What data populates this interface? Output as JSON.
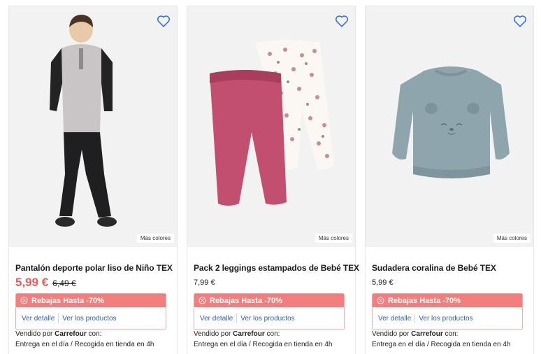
{
  "products": [
    {
      "title": "Pantalón deporte polar liso de Niño TEX",
      "price_sale": "5,99 €",
      "price_old": "6,49 €",
      "more_colors": "Más colores",
      "promo": "Rebajas Hasta -70%",
      "link_detail": "Ver detalle",
      "link_products": "Ver los productos",
      "seller_prefix": "Vendido por ",
      "seller_name": "Carrefour",
      "seller_suffix": " con:",
      "delivery": "Entrega en el día /  Recogida en tienda en 4h"
    },
    {
      "title": "Pack 2 leggings estampados de Bebé TEX",
      "price": "7,99 €",
      "more_colors": "Más colores",
      "promo": "Rebajas Hasta -70%",
      "link_detail": "Ver detalle",
      "link_products": "Ver los productos",
      "seller_prefix": "Vendido por ",
      "seller_name": "Carrefour",
      "seller_suffix": " con:",
      "delivery": "Entrega en el día /  Recogida en tienda en 4h"
    },
    {
      "title": "Sudadera coralina de Bebé TEX",
      "price": "5,99 €",
      "more_colors": "Más colores",
      "promo": "Rebajas Hasta -70%",
      "link_detail": "Ver detalle",
      "link_products": "Ver los productos",
      "seller_prefix": "Vendido por ",
      "seller_name": "Carrefour",
      "seller_suffix": " con:",
      "delivery": "Entrega en el día /  Recogida en tienda en 4h"
    }
  ],
  "colors": {
    "sale_price": "#e95c5c",
    "promo_band": "#f47d7d",
    "link": "#2f5fa8",
    "favorite_icon": "#2f6fd6"
  },
  "icons": {
    "favorite": "heart-outline-icon",
    "promo": "discount-badge-icon"
  }
}
